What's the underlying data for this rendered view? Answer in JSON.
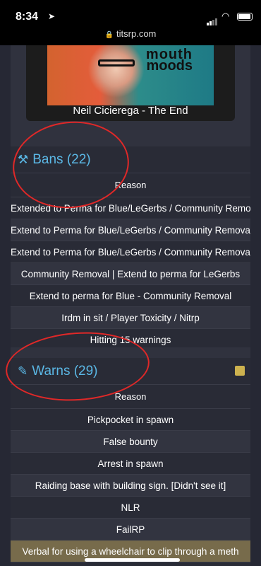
{
  "status": {
    "time": "8:34"
  },
  "browser": {
    "url": "titsrp.com"
  },
  "video": {
    "caption": "Neil Cicierega - The End",
    "thumb_text_1": "mouth",
    "thumb_text_2": "moods"
  },
  "bans": {
    "title": "Bans (22)",
    "column": "Reason",
    "rows": [
      "Extended to Perma for Blue/LeGerbs / Community Removal",
      "Extend to Perma for Blue/LeGerbs / Community Removal",
      "Extend to Perma for Blue/LeGerbs / Community Removal",
      "Community Removal | Extend to perma for LeGerbs",
      "Extend to perma for Blue - Community Removal",
      "Irdm in sit / Player Toxicity / Nitrp",
      "Hitting 15 warnings"
    ]
  },
  "warns": {
    "title": "Warns (29)",
    "column": "Reason",
    "rows": [
      "Pickpocket in spawn",
      "False bounty",
      "Arrest in spawn",
      "Raiding base with building sign. [Didn't see it]",
      "NLR",
      "FailRP",
      "Verbal for using a wheelchair to clip through a meth"
    ]
  },
  "colors": {
    "accent": "#5bb8e6",
    "annotation": "#e02828",
    "highlight": "#776b4b"
  },
  "icons": {
    "bans": "gavel-icon",
    "warns": "pencil-icon",
    "note": "sticky-note-icon"
  }
}
